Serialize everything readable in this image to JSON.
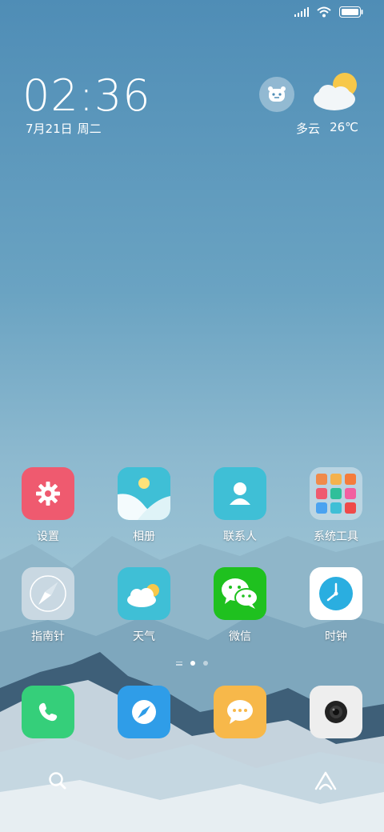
{
  "clock": {
    "time": "02:36",
    "date": "7月21日",
    "weekday": "周二"
  },
  "weather": {
    "condition": "多云",
    "temperature": "26℃"
  },
  "apps_row1": [
    {
      "label": "设置",
      "icon": "gear-icon"
    },
    {
      "label": "相册",
      "icon": "gallery-icon"
    },
    {
      "label": "联系人",
      "icon": "contacts-icon"
    },
    {
      "label": "系统工具",
      "icon": "folder-icon"
    }
  ],
  "apps_row2": [
    {
      "label": "指南针",
      "icon": "compass-icon"
    },
    {
      "label": "天气",
      "icon": "weather-app-icon"
    },
    {
      "label": "微信",
      "icon": "wechat-icon"
    },
    {
      "label": "时钟",
      "icon": "clock-icon"
    }
  ],
  "dock": [
    {
      "icon": "phone-icon"
    },
    {
      "icon": "browser-icon"
    },
    {
      "icon": "messages-icon"
    },
    {
      "icon": "camera-icon"
    }
  ],
  "colors": {
    "settings": "#ef5a6f",
    "contacts": "#3fbfd6",
    "wechat": "#1fc11f",
    "phone": "#35cf7a",
    "browser": "#2f9de8",
    "messages": "#f7b84a"
  }
}
